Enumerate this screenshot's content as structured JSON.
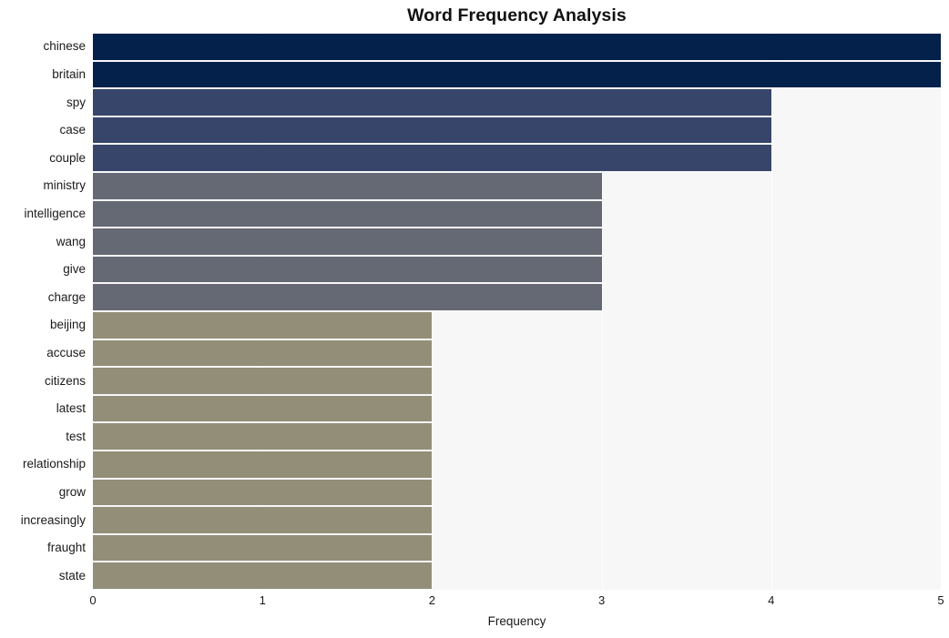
{
  "chart_data": {
    "type": "bar",
    "orientation": "horizontal",
    "title": "Word Frequency Analysis",
    "xlabel": "Frequency",
    "ylabel": "",
    "xlim": [
      0,
      5
    ],
    "xticks": [
      0,
      1,
      2,
      3,
      4,
      5
    ],
    "xtick_labels": [
      "0",
      "1",
      "2",
      "3",
      "4",
      "5"
    ],
    "grid": true,
    "grid_axis": "x",
    "legend": false,
    "categories": [
      "chinese",
      "britain",
      "spy",
      "case",
      "couple",
      "ministry",
      "intelligence",
      "wang",
      "give",
      "charge",
      "beijing",
      "accuse",
      "citizens",
      "latest",
      "test",
      "relationship",
      "grow",
      "increasingly",
      "fraught",
      "state"
    ],
    "values": [
      5,
      5,
      4,
      4,
      4,
      3,
      3,
      3,
      3,
      3,
      2,
      2,
      2,
      2,
      2,
      2,
      2,
      2,
      2,
      2
    ],
    "bar_colors": [
      "#04214c",
      "#04214c",
      "#38456a",
      "#38456a",
      "#38456a",
      "#656973",
      "#656973",
      "#656973",
      "#656973",
      "#656973",
      "#938e78",
      "#938e78",
      "#938e78",
      "#938e78",
      "#938e78",
      "#938e78",
      "#938e78",
      "#938e78",
      "#938e78",
      "#938e78"
    ]
  },
  "style": {
    "plot_background": "#f7f7f8",
    "page_background": "#ffffff",
    "gridline_color": "#ffffff",
    "text_color": "#1a1a1a"
  }
}
